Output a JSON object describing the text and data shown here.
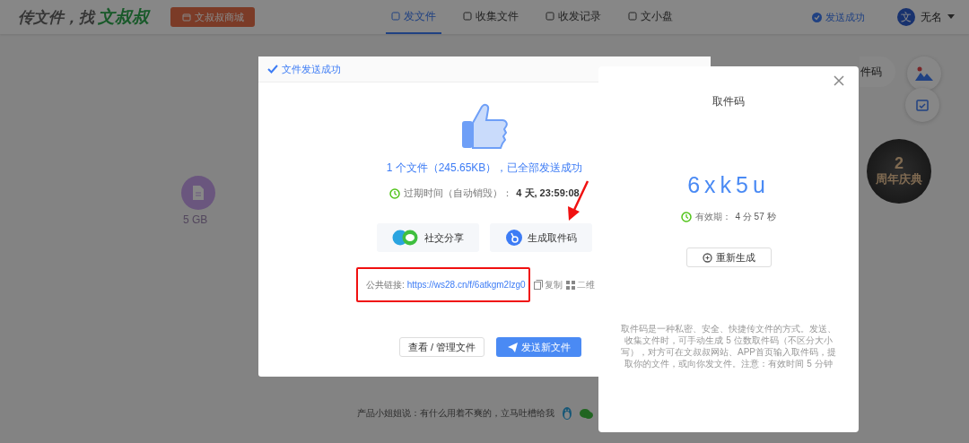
{
  "header": {
    "logo_prefix": "传文件，找",
    "logo_name": "文叔叔",
    "store_button": "文叔叔商城",
    "tabs": [
      {
        "label": "发文件",
        "selected": true
      },
      {
        "label": "收集文件",
        "selected": false
      },
      {
        "label": "收发记录",
        "selected": false
      },
      {
        "label": "文小盘",
        "selected": false
      }
    ],
    "status": "发送成功",
    "avatar_letter": "文",
    "user_name": "无名"
  },
  "background": {
    "storage": "5 GB",
    "pickup_pill": "件码",
    "badge": {
      "number": "2",
      "title": "周年庆典"
    },
    "footer": "产品小姐姐说：有什么用着不爽的，立马吐槽给我"
  },
  "send_dialog": {
    "title": "文件发送成功",
    "summary": "1 个文件（245.65KB），已全部发送成功",
    "expiry_label": "过期时间（自动销毁）：",
    "expiry_value": "4 天, 23:59:08",
    "share_buttons": [
      {
        "kind": "social",
        "label": "社交分享"
      },
      {
        "kind": "code",
        "label": "生成取件码"
      }
    ],
    "link_label": "公共链接:",
    "link_url": "https://ws28.cn/f/6atkgm2lzg0",
    "copy": "复制",
    "qr": "二维",
    "manage_button": "查看 / 管理文件",
    "send_button": "发送新文件"
  },
  "pickup_panel": {
    "title": "取件码",
    "code": "6xk5u",
    "validity_label": "有效期：",
    "validity_value": "4 分 57 秒",
    "regenerate": "重新生成",
    "description": "取件码是一种私密、安全、快捷传文件的方式。发送、收集文件时，可手动生成 5 位数取件码（不区分大小写），对方可在文叔叔网站、APP首页输入取件码，提取你的文件，或向你发文件。注意：有效时间 5 分钟"
  }
}
